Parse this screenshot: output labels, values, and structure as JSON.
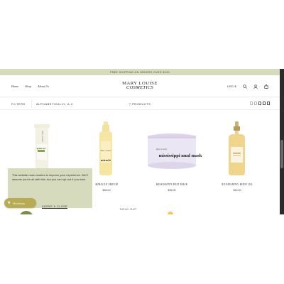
{
  "announcement": "Free shipping on orders over $100",
  "header": {
    "nav": [
      "Home",
      "Shop",
      "About Us"
    ],
    "logo_line1": "MARY LOUISE",
    "logo_line2": "COSMETICS",
    "currency": "USD $",
    "icons": [
      "search-icon",
      "account-icon",
      "cart-icon"
    ]
  },
  "filterbar": {
    "filters_label": "FILTERS",
    "sort_label": "ALPHABETICALLY, A-Z",
    "count_label": "7 PRODUCTS"
  },
  "products": [
    {
      "name": "",
      "price": "",
      "label_text": "Mary Louise",
      "product_text": "green tea"
    },
    {
      "name": "MIRACLE SERUM",
      "price": "$35.00",
      "label_text": "Mary Louise",
      "product_text": "miracle"
    },
    {
      "name": "MISSISSIPPI MUD MASK",
      "price": "$38.00",
      "label_text": "Mary Louise",
      "product_text": "mississippi mud mask"
    },
    {
      "name": "NOURISHING BODY OIL",
      "price": "$40.00",
      "label_text": "",
      "product_text": ""
    }
  ],
  "sold_out": "SOLD OUT",
  "cookie": {
    "text": "This website uses cookies to improve your experience. We'll assume you're ok with this, but you can opt-out if you wish.",
    "agree_label": "AGREE & CLOSE"
  },
  "reviews_label": "Reviews",
  "colors": {
    "announcement_bg": "#d6dbbe",
    "cookie_bg": "#d6dbbe",
    "reviews_badge": "#b7ab55",
    "dark_scrollbar": "#2b2b2b"
  }
}
